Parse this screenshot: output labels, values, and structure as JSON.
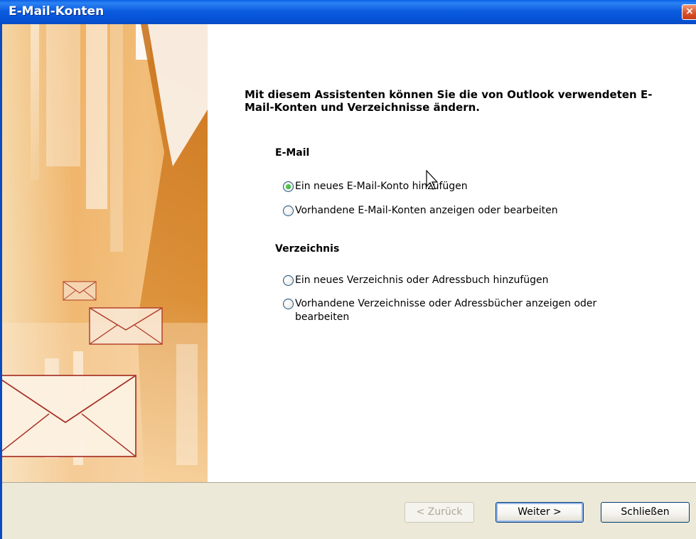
{
  "window": {
    "title": "E-Mail-Konten",
    "close_glyph": "×"
  },
  "intro": {
    "heading": "Mit diesem Assistenten können Sie die von Outlook verwendeten E-Mail-Konten und Verzeichnisse ändern."
  },
  "email_section": {
    "title": "E-Mail",
    "options": [
      {
        "label": "Ein neues E-Mail-Konto hinzufügen",
        "selected": true
      },
      {
        "label": "Vorhandene E-Mail-Konten anzeigen oder bearbeiten",
        "selected": false
      }
    ]
  },
  "directory_section": {
    "title": "Verzeichnis",
    "options": [
      {
        "label": "Ein neues Verzeichnis oder Adressbuch hinzufügen",
        "selected": false
      },
      {
        "label": "Vorhandene Verzeichnisse oder Adressbücher anzeigen oder bearbeiten",
        "selected": false
      }
    ]
  },
  "buttons": {
    "back": "< Zurück",
    "next": "Weiter >",
    "close": "Schließen"
  },
  "colors": {
    "titlebar": "#0552d6",
    "banner_orange": "#e8962e",
    "footer": "#ece9d8"
  },
  "icons": [
    "close-icon",
    "envelope-icon",
    "radio-icon",
    "mouse-cursor-icon"
  ]
}
